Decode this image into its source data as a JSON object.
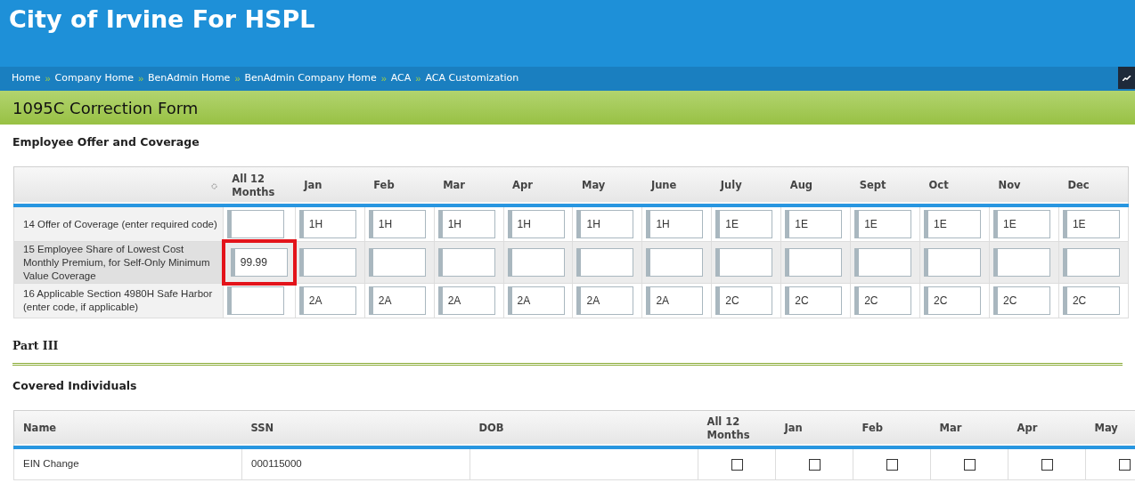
{
  "header": {
    "title": "City of Irvine For HSPL"
  },
  "breadcrumbs": {
    "separator": "»",
    "items": [
      "Home",
      "Company Home",
      "BenAdmin Home",
      "BenAdmin Company Home",
      "ACA",
      "ACA Customization"
    ]
  },
  "page_title": "1095C Correction Form",
  "offer_section": {
    "title": "Employee Offer and Coverage",
    "columns": [
      "All 12 Months",
      "Jan",
      "Feb",
      "Mar",
      "Apr",
      "May",
      "June",
      "July",
      "Aug",
      "Sept",
      "Oct",
      "Nov",
      "Dec"
    ],
    "rows": [
      {
        "label": "14 Offer of Coverage (enter required code)",
        "cells": [
          {
            "highlighted": false
          },
          {
            "value": "1H",
            "highlighted": false
          },
          {
            "value": "1H",
            "highlighted": false
          },
          {
            "value": "1H",
            "highlighted": false
          },
          {
            "value": "1H",
            "highlighted": false
          },
          {
            "value": "1H",
            "highlighted": false
          },
          {
            "value": "1H",
            "highlighted": false
          },
          {
            "value": "1E",
            "highlighted": false
          },
          {
            "value": "1E",
            "highlighted": false
          },
          {
            "value": "1E",
            "highlighted": false
          },
          {
            "value": "1E",
            "highlighted": false
          },
          {
            "value": "1E",
            "highlighted": false
          },
          {
            "value": "1E",
            "highlighted": false
          }
        ]
      },
      {
        "label": "15 Employee Share of Lowest Cost Monthly Premium, for Self-Only Minimum Value Coverage",
        "cells": [
          {
            "value": "99.99",
            "highlighted": true
          },
          {
            "highlighted": false
          },
          {
            "highlighted": false
          },
          {
            "highlighted": false
          },
          {
            "highlighted": false
          },
          {
            "highlighted": false
          },
          {
            "highlighted": false
          },
          {
            "highlighted": false
          },
          {
            "highlighted": false
          },
          {
            "highlighted": false
          },
          {
            "highlighted": false
          },
          {
            "highlighted": false
          },
          {
            "highlighted": false
          }
        ]
      },
      {
        "label": "16 Applicable Section 4980H Safe Harbor (enter code, if applicable)",
        "cells": [
          {
            "highlighted": false
          },
          {
            "value": "2A",
            "highlighted": false
          },
          {
            "value": "2A",
            "highlighted": false
          },
          {
            "value": "2A",
            "highlighted": false
          },
          {
            "value": "2A",
            "highlighted": false
          },
          {
            "value": "2A",
            "highlighted": false
          },
          {
            "value": "2A",
            "highlighted": false
          },
          {
            "value": "2C",
            "highlighted": false
          },
          {
            "value": "2C",
            "highlighted": false
          },
          {
            "value": "2C",
            "highlighted": false
          },
          {
            "value": "2C",
            "highlighted": false
          },
          {
            "value": "2C",
            "highlighted": false
          },
          {
            "value": "2C",
            "highlighted": false
          }
        ]
      }
    ]
  },
  "part_title": "Part III",
  "covered_section": {
    "title": "Covered Individuals",
    "columns": [
      "Name",
      "SSN",
      "DOB",
      "All 12 Months",
      "Jan",
      "Feb",
      "Mar",
      "Apr",
      "May"
    ],
    "rows": [
      {
        "name": "EIN Change",
        "ssn": "000115000",
        "months": [
          {
            "checked": false
          },
          {
            "checked": false
          },
          {
            "checked": false
          },
          {
            "checked": false
          },
          {
            "checked": false
          },
          {
            "checked": false
          }
        ]
      }
    ]
  }
}
